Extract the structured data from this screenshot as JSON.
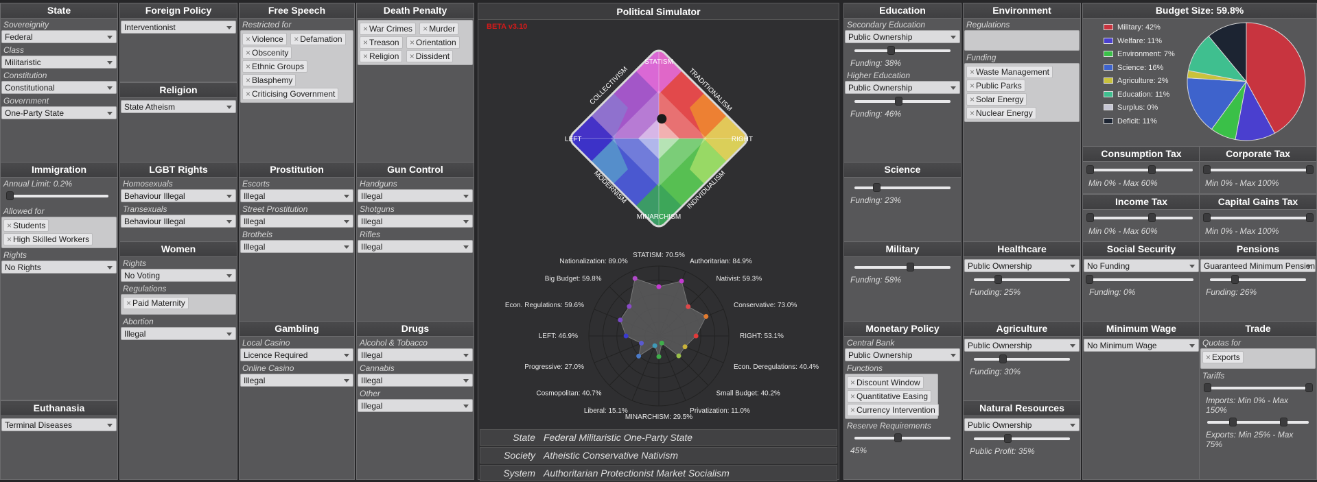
{
  "app": {
    "title": "Political Simulator",
    "beta": "BETA v3.10"
  },
  "state_panel": {
    "title": "State",
    "fields": [
      {
        "label": "Sovereignity",
        "value": "Federal"
      },
      {
        "label": "Class",
        "value": "Militaristic"
      },
      {
        "label": "Constitution",
        "value": "Constitutional"
      },
      {
        "label": "Government",
        "value": "One-Party State"
      }
    ]
  },
  "foreign_policy": {
    "title": "Foreign Policy",
    "value": "Interventionist"
  },
  "religion": {
    "title": "Religion",
    "value": "State Atheism"
  },
  "free_speech": {
    "title": "Free Speech",
    "label": "Restricted for",
    "tags": [
      "Violence",
      "Defamation",
      "Obscenity",
      "Ethnic Groups",
      "Blasphemy",
      "Criticising Government"
    ]
  },
  "death_penalty": {
    "title": "Death Penalty",
    "tags": [
      "War Crimes",
      "Murder",
      "Treason",
      "Orientation",
      "Religion",
      "Dissident"
    ]
  },
  "immigration": {
    "title": "Immigration",
    "limit_label": "Annual Limit: 0.2%",
    "limit_value": 0.2,
    "allowed_label": "Allowed for",
    "allowed": [
      "Students",
      "High Skilled Workers"
    ],
    "rights_label": "Rights",
    "rights": "No Rights"
  },
  "lgbt": {
    "title": "LGBT Rights",
    "fields": [
      {
        "label": "Homosexuals",
        "value": "Behaviour Illegal"
      },
      {
        "label": "Transexuals",
        "value": "Behaviour Illegal"
      }
    ]
  },
  "women": {
    "title": "Women",
    "rights_label": "Rights",
    "rights": "No Voting",
    "reg_label": "Regulations",
    "regs": [
      "Paid Maternity"
    ],
    "abortion_label": "Abortion",
    "abortion": "Illegal"
  },
  "prostitution": {
    "title": "Prostitution",
    "fields": [
      {
        "label": "Escorts",
        "value": "Illegal"
      },
      {
        "label": "Street Prostitution",
        "value": "Illegal"
      },
      {
        "label": "Brothels",
        "value": "Illegal"
      }
    ]
  },
  "gun_control": {
    "title": "Gun Control",
    "fields": [
      {
        "label": "Handguns",
        "value": "Illegal"
      },
      {
        "label": "Shotguns",
        "value": "Illegal"
      },
      {
        "label": "Rifles",
        "value": "Illegal"
      }
    ]
  },
  "gambling": {
    "title": "Gambling",
    "fields": [
      {
        "label": "Local Casino",
        "value": "Licence Required"
      },
      {
        "label": "Online Casino",
        "value": "Illegal"
      }
    ]
  },
  "drugs": {
    "title": "Drugs",
    "fields": [
      {
        "label": "Alcohol & Tobacco",
        "value": "Illegal"
      },
      {
        "label": "Cannabis",
        "value": "Illegal"
      },
      {
        "label": "Other",
        "value": "Illegal"
      }
    ]
  },
  "euthanasia": {
    "title": "Euthanasia",
    "value": "Terminal Diseases"
  },
  "compass": {
    "labels": {
      "top": "STATISM",
      "bottom": "MINARCHISM",
      "left": "LEFT",
      "right": "RIGHT",
      "tl": "COLLECTIVISM",
      "tr": "TRADITIONALISM",
      "bl": "MODERNISM",
      "br": "INDIVIDUALISM"
    },
    "dot": {
      "statism": 70.5,
      "right": 53.1
    }
  },
  "radar": [
    {
      "label": "STATISM: 70.5%",
      "v": 70.5
    },
    {
      "label": "Authoritarian: 84.9%",
      "v": 84.9
    },
    {
      "label": "Nativist: 59.3%",
      "v": 59.3
    },
    {
      "label": "Conservative: 73.0%",
      "v": 73.0
    },
    {
      "label": "RIGHT: 53.1%",
      "v": 53.1
    },
    {
      "label": "Econ. Deregulations: 40.4%",
      "v": 40.4
    },
    {
      "label": "Small Budget: 40.2%",
      "v": 40.2
    },
    {
      "label": "Privatization: 11.0%",
      "v": 11.0
    },
    {
      "label": "MINARCHISM: 29.5%",
      "v": 29.5
    },
    {
      "label": "Liberal: 15.1%",
      "v": 15.1
    },
    {
      "label": "Cosmopolitan: 40.7%",
      "v": 40.7
    },
    {
      "label": "Progressive: 27.0%",
      "v": 27.0
    },
    {
      "label": "LEFT: 46.9%",
      "v": 46.9
    },
    {
      "label": "Econ. Regulations: 59.6%",
      "v": 59.6
    },
    {
      "label": "Big Budget: 59.8%",
      "v": 59.8
    },
    {
      "label": "Nationalization: 89.0%",
      "v": 89.0
    }
  ],
  "summary": [
    {
      "k": "State",
      "v": "Federal Militaristic One-Party State"
    },
    {
      "k": "Society",
      "v": "Atheistic Conservative Nativism"
    },
    {
      "k": "System",
      "v": "Authoritarian Protectionist Market Socialism"
    }
  ],
  "education": {
    "title": "Education",
    "sec_label": "Secondary Education",
    "sec_value": "Public Ownership",
    "sec_funding": "Funding: 38%",
    "sec_f": 38,
    "high_label": "Higher Education",
    "high_value": "Public Ownership",
    "high_funding": "Funding: 46%",
    "high_f": 46
  },
  "environment": {
    "title": "Environment",
    "reg_label": "Regulations",
    "fund_label": "Funding",
    "funding": [
      "Waste Management",
      "Public Parks",
      "Solar Energy",
      "Nuclear Energy"
    ]
  },
  "science": {
    "title": "Science",
    "funding": "Funding: 23%",
    "f": 23
  },
  "military": {
    "title": "Military",
    "funding": "Funding: 58%",
    "f": 58
  },
  "monetary": {
    "title": "Monetary Policy",
    "cb_label": "Central Bank",
    "cb": "Public Ownership",
    "fn_label": "Functions",
    "functions": [
      "Discount Window",
      "Quantitative Easing",
      "Currency Intervention"
    ],
    "rr_label": "Reserve Requirements",
    "rr": "45%",
    "rr_v": 45
  },
  "healthcare": {
    "title": "Healthcare",
    "value": "Public Ownership",
    "funding": "Funding: 25%",
    "f": 25
  },
  "agriculture": {
    "title": "Agriculture",
    "value": "Public Ownership",
    "funding": "Funding: 30%",
    "f": 30
  },
  "natural_resources": {
    "title": "Natural Resources",
    "value": "Public Ownership",
    "profit": "Public Profit: 35%",
    "f": 35
  },
  "budget": {
    "title": "Budget Size: 59.8%",
    "items": [
      {
        "label": "Military: 42%",
        "v": 42,
        "color": "#c8343f"
      },
      {
        "label": "Welfare: 11%",
        "v": 11,
        "color": "#4a3fcf"
      },
      {
        "label": "Environment: 7%",
        "v": 7,
        "color": "#3ac048"
      },
      {
        "label": "Science: 16%",
        "v": 16,
        "color": "#3e63cc"
      },
      {
        "label": "Agriculture: 2%",
        "v": 2,
        "color": "#c9c23c"
      },
      {
        "label": "Education: 11%",
        "v": 11,
        "color": "#3fbf8f"
      },
      {
        "label": "Surplus: 0%",
        "v": 0,
        "color": "#c6c6d4"
      },
      {
        "label": "Deficit: 11%",
        "v": 11,
        "color": "#1c2432"
      }
    ]
  },
  "consumption_tax": {
    "title": "Consumption Tax",
    "range": "Min 0% - Max 60%",
    "lo": 0,
    "hi": 60,
    "max": 100
  },
  "corporate_tax": {
    "title": "Corporate Tax",
    "range": "Min 0% - Max 100%",
    "lo": 0,
    "hi": 100,
    "max": 100
  },
  "income_tax": {
    "title": "Income Tax",
    "range": "Min 0% - Max 60%",
    "lo": 0,
    "hi": 60,
    "max": 100
  },
  "capital_gains_tax": {
    "title": "Capital Gains Tax",
    "range": "Min 0% - Max 100%",
    "lo": 0,
    "hi": 100,
    "max": 100
  },
  "social_security": {
    "title": "Social Security",
    "value": "No Funding",
    "funding": "Funding: 0%",
    "f": 0
  },
  "pensions": {
    "title": "Pensions",
    "value": "Guaranteed Minimum Pension",
    "funding": "Funding: 26%",
    "f": 26
  },
  "minimum_wage": {
    "title": "Minimum Wage",
    "value": "No Minimum Wage"
  },
  "trade": {
    "title": "Trade",
    "quota_label": "Quotas for",
    "quotas": [
      "Exports"
    ],
    "tariff_label": "Tariffs",
    "imports": "Imports: Min 0% - Max 150%",
    "exports": "Exports: Min 25% - Max 75%"
  }
}
